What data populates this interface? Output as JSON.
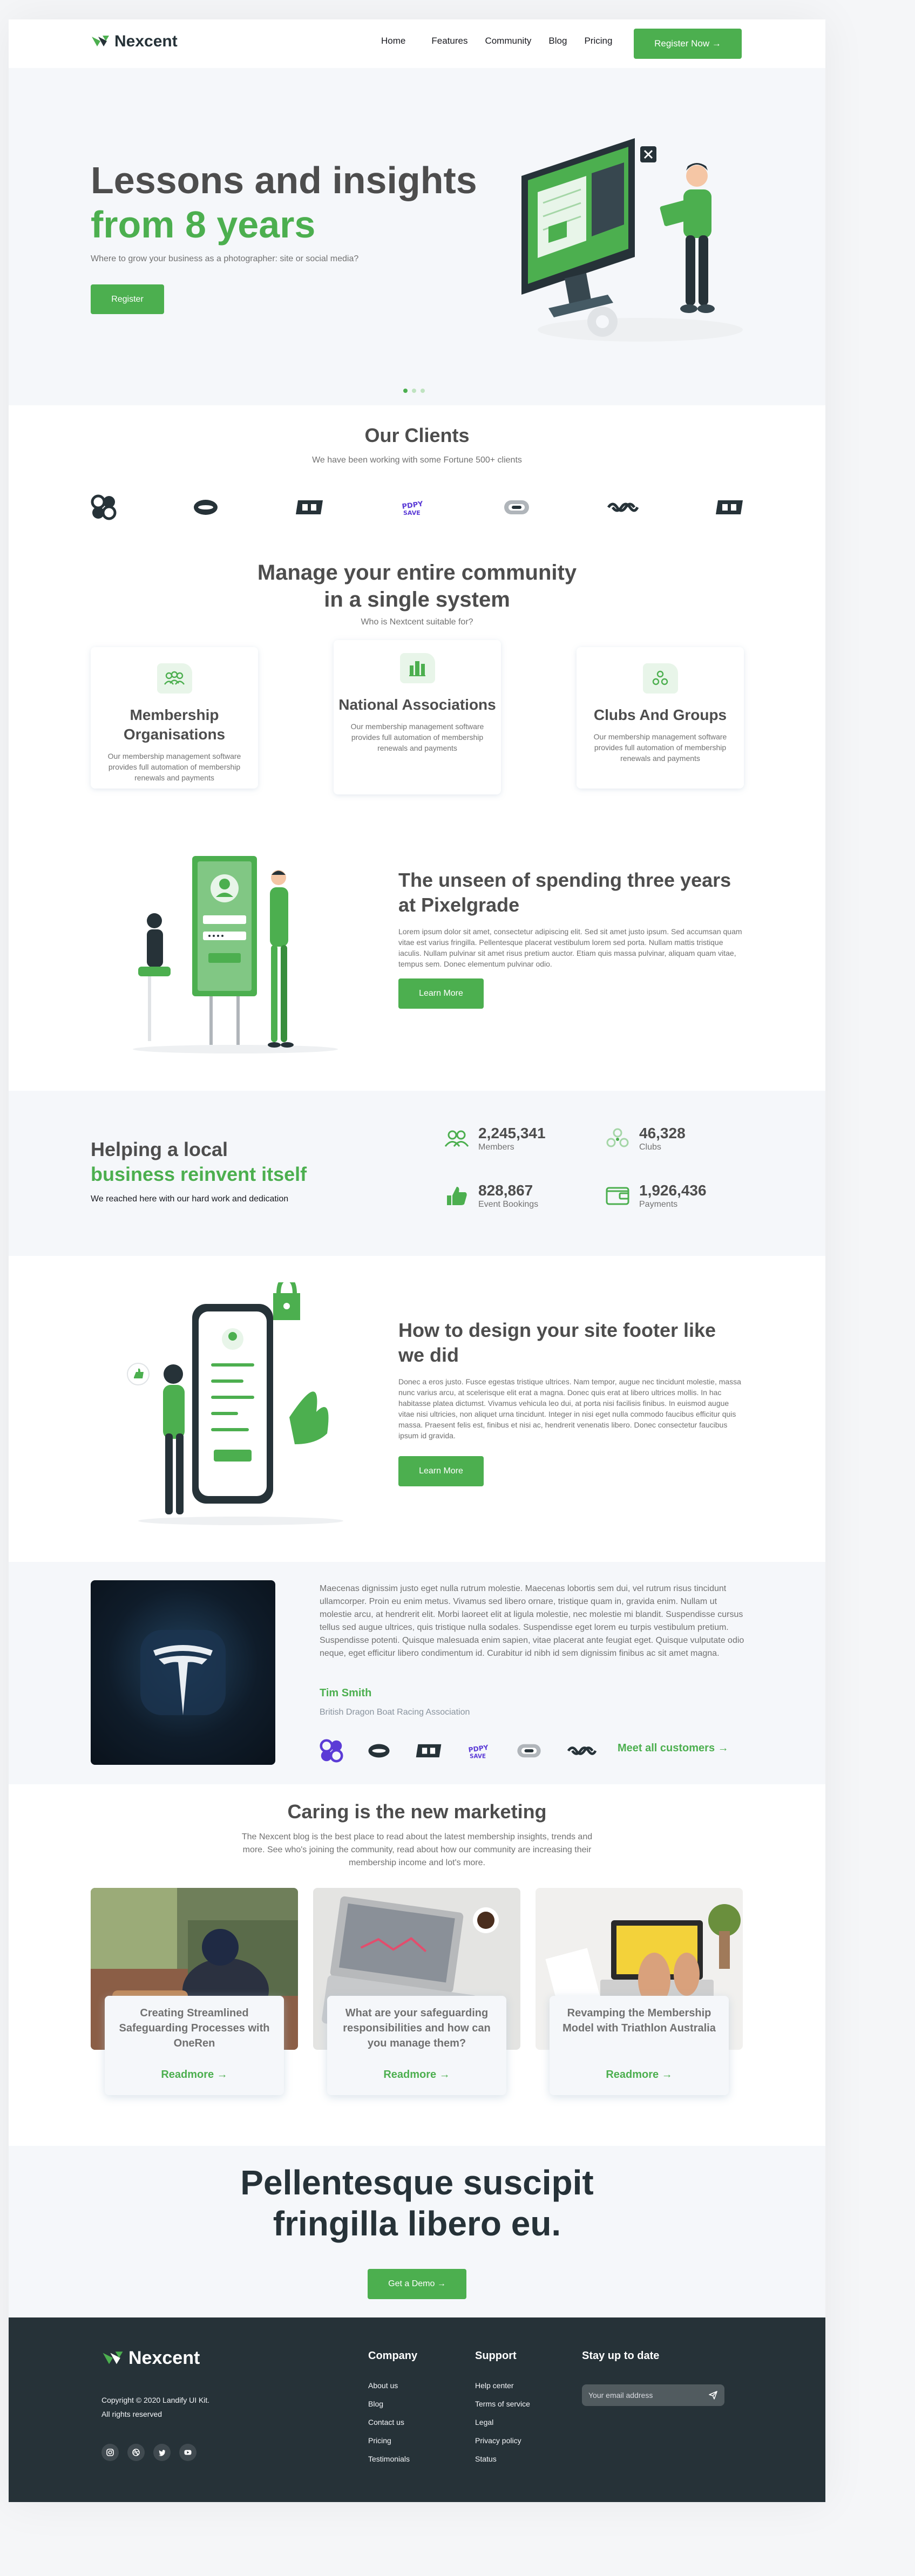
{
  "header": {
    "brand": "Nexcent",
    "nav": [
      "Home",
      "Features",
      "Community",
      "Blog",
      "Pricing"
    ],
    "cta_label": "Register Now →"
  },
  "hero": {
    "title_line1": "Lessons and insights",
    "title_line2": "from 8 years",
    "subtitle": "Where to grow your business as a photographer: site or social media?",
    "button_label": "Register"
  },
  "clients": {
    "title": "Our Clients",
    "subtitle": "We have been working with some Fortune 500+ clients"
  },
  "community": {
    "title_line1": "Manage your entire community",
    "title_line2": "in a single system",
    "subtitle": "Who is Nextcent suitable for?",
    "cards": [
      {
        "title": "Membership Organisations",
        "text": "Our membership management software provides full automation of membership renewals and payments"
      },
      {
        "title": "National Associations",
        "text": "Our membership management software provides full automation of membership renewals and payments"
      },
      {
        "title": "Clubs And Groups",
        "text": "Our membership management software provides full automation of membership renewals and payments"
      }
    ]
  },
  "feature1": {
    "title": "The unseen of spending three years at Pixelgrade",
    "text": "Lorem ipsum dolor sit amet, consectetur adipiscing elit. Sed sit amet justo ipsum. Sed accumsan quam vitae est varius fringilla. Pellentesque placerat vestibulum lorem sed porta. Nullam mattis tristique iaculis. Nullam pulvinar sit amet risus pretium auctor. Etiam quis massa pulvinar, aliquam quam vitae, tempus sem. Donec elementum pulvinar odio.",
    "button_label": "Learn More"
  },
  "stats": {
    "title_line1": "Helping a local",
    "title_line2": "business reinvent itself",
    "subtitle": "We reached here with our hard work and dedication",
    "items": [
      {
        "value": "2,245,341",
        "label": "Members"
      },
      {
        "value": "46,328",
        "label": "Clubs"
      },
      {
        "value": "828,867",
        "label": "Event Bookings"
      },
      {
        "value": "1,926,436",
        "label": "Payments"
      }
    ]
  },
  "feature2": {
    "title": "How to design your site footer like we did",
    "text": "Donec a eros justo. Fusce egestas tristique ultrices. Nam tempor, augue nec tincidunt molestie, massa nunc varius arcu, at scelerisque elit erat a magna. Donec quis erat at libero ultrices mollis. In hac habitasse platea dictumst. Vivamus vehicula leo dui, at porta nisi facilisis finibus. In euismod augue vitae nisi ultricies, non aliquet urna tincidunt. Integer in nisi eget nulla commodo faucibus efficitur quis massa. Praesent felis est, finibus et nisi ac, hendrerit venenatis libero. Donec consectetur faucibus ipsum id gravida.",
    "button_label": "Learn More"
  },
  "testimonial": {
    "quote": "Maecenas dignissim justo eget nulla rutrum molestie. Maecenas lobortis sem dui, vel rutrum risus tincidunt ullamcorper. Proin eu enim metus. Vivamus sed libero ornare, tristique quam in, gravida enim. Nullam ut molestie arcu, at hendrerit elit. Morbi laoreet elit at ligula molestie, nec molestie mi blandit. Suspendisse cursus tellus sed augue ultrices, quis tristique nulla sodales. Suspendisse eget lorem eu turpis vestibulum pretium. Suspendisse potenti. Quisque malesuada enim sapien, vitae placerat ante feugiat eget. Quisque vulputate odio neque, eget efficitur libero condimentum id. Curabitur id nibh id sem dignissim finibus ac sit amet magna.",
    "name": "Tim Smith",
    "role": "British Dragon Boat Racing Association",
    "meet_label": "Meet all customers  →"
  },
  "blog": {
    "title": "Caring is the new marketing",
    "subtitle": "The Nexcent blog is the best place to read about the latest membership insights, trends and more. See who's joining the community, read about how our community are increasing their membership income and lot's more.",
    "posts": [
      {
        "title": "Creating Streamlined Safeguarding Processes with OneRen",
        "link": "Readmore  →"
      },
      {
        "title": "What are your safeguarding responsibilities and how can you manage them?",
        "link": "Readmore  →"
      },
      {
        "title": "Revamping the Membership Model with Triathlon Australia",
        "link": "Readmore  →"
      }
    ]
  },
  "cta": {
    "title_line1": "Pellentesque suscipit",
    "title_line2": "fringilla libero eu.",
    "button_label": "Get a Demo  →"
  },
  "footer": {
    "brand": "Nexcent",
    "copyright": "Copyright © 2020 Landify UI Kit.",
    "rights": "All rights reserved",
    "company": {
      "title": "Company",
      "links": [
        "About us",
        "Blog",
        "Contact us",
        "Pricing",
        "Testimonials"
      ]
    },
    "support": {
      "title": "Support",
      "links": [
        "Help center",
        "Terms of service",
        "Legal",
        "Privacy policy",
        "Status"
      ]
    },
    "newsletter": {
      "title": "Stay up to date",
      "placeholder": "Your email address"
    }
  },
  "colors": {
    "brand": "#4caf4f",
    "dark": "#263238",
    "text": "#4d4d4d",
    "muted": "#717171",
    "light_bg": "#f5f7fa"
  },
  "icons": [
    "logo-icon",
    "members-icon",
    "clubs-icon",
    "event-bookings-icon",
    "payments-icon",
    "send-icon",
    "instagram-icon",
    "dribbble-icon",
    "twitter-icon",
    "youtube-icon",
    "arrow-right-icon"
  ]
}
